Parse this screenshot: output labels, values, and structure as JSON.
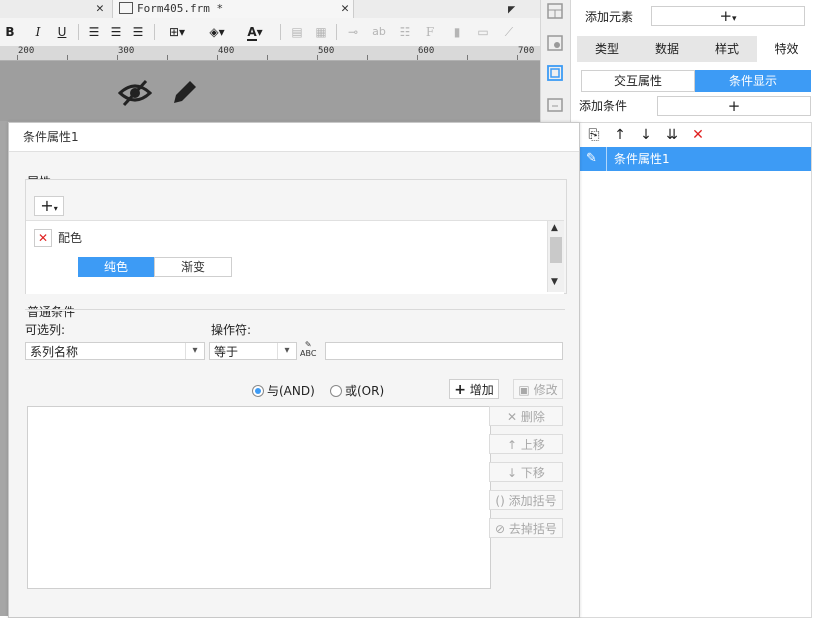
{
  "editor": {
    "tab_title": "Form405.frm *",
    "ruler_labels": [
      "200",
      "300",
      "400",
      "500",
      "600",
      "700"
    ]
  },
  "toolbar": {
    "bold": "B",
    "italic": "I",
    "underline": "U",
    "font_color_glyph": "A",
    "text_glyph": "ab"
  },
  "right_panel": {
    "add_element_label": "添加元素",
    "type_tabs": [
      "类型",
      "数据",
      "样式",
      "特效"
    ],
    "active_type_tab": "特效",
    "sub_tabs": [
      "交互属性",
      "条件显示"
    ],
    "active_sub_tab": "条件显示",
    "add_condition_label": "添加条件",
    "condition_items": [
      "条件属性1"
    ]
  },
  "dialog": {
    "title": "条件属性1",
    "attributes_label": "属性:",
    "attribute_item": "配色",
    "color_modes": [
      "纯色",
      "渐变"
    ],
    "active_color_mode": "纯色",
    "normal_conditions_label": "普通条件",
    "optional_column_label": "可选列:",
    "operator_label": "操作符:",
    "column_value": "系列名称",
    "operator_value": "等于",
    "and_label": "与(AND)",
    "or_label": "或(OR)",
    "logic_selected": "and",
    "buttons": {
      "add": "增加",
      "modify": "修改",
      "delete": "删除",
      "move_up": "上移",
      "move_down": "下移",
      "add_bracket": "添加括号",
      "remove_bracket": "去掉括号"
    }
  },
  "colors": {
    "accent": "#3d9bf5",
    "delete_red": "#e02020"
  }
}
